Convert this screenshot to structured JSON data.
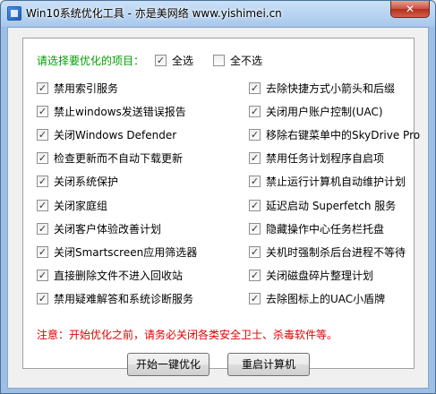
{
  "window": {
    "title": "Win10系统优化工具 - 亦是美网络 www.yishimei.cn",
    "close_glyph": "✕"
  },
  "selection": {
    "prompt": "请选择要优化的项目：",
    "select_all": "全选",
    "select_none": "全不选",
    "select_all_checked": true,
    "select_none_checked": false
  },
  "options_left": [
    {
      "label": "禁用索引服务",
      "checked": true
    },
    {
      "label": "禁止windows发送错误报告",
      "checked": true
    },
    {
      "label": "关闭Windows Defender",
      "checked": true
    },
    {
      "label": "检查更新而不自动下载更新",
      "checked": true
    },
    {
      "label": "关闭系统保护",
      "checked": true
    },
    {
      "label": "关闭家庭组",
      "checked": true
    },
    {
      "label": "关闭客户体验改善计划",
      "checked": true
    },
    {
      "label": "关闭Smartscreen应用筛选器",
      "checked": true
    },
    {
      "label": "直接删除文件不进入回收站",
      "checked": true
    },
    {
      "label": "禁用疑难解答和系统诊断服务",
      "checked": true
    }
  ],
  "options_right": [
    {
      "label": "去除快捷方式小箭头和后缀",
      "checked": true
    },
    {
      "label": "关闭用户账户控制(UAC)",
      "checked": true
    },
    {
      "label": "移除右键菜单中的SkyDrive Pro",
      "checked": true
    },
    {
      "label": "禁用任务计划程序自启项",
      "checked": true
    },
    {
      "label": "禁止运行计算机自动维护计划",
      "checked": true
    },
    {
      "label": "延迟启动 Superfetch 服务",
      "checked": true
    },
    {
      "label": "隐藏操作中心任务栏托盘",
      "checked": true
    },
    {
      "label": "关机时强制杀后台进程不等待",
      "checked": true
    },
    {
      "label": "关闭磁盘碎片整理计划",
      "checked": true
    },
    {
      "label": "去除图标上的UAC小盾牌",
      "checked": true
    }
  ],
  "warning": "注意：开始优化之前，请务必关闭各类安全卫士、杀毒软件等。",
  "buttons": {
    "start": "开始一键优化",
    "restart": "重启计算机"
  },
  "check_glyph": "✓",
  "colors": {
    "prompt": "#00a000",
    "warning": "#e00000",
    "close_button": "#c75142"
  }
}
